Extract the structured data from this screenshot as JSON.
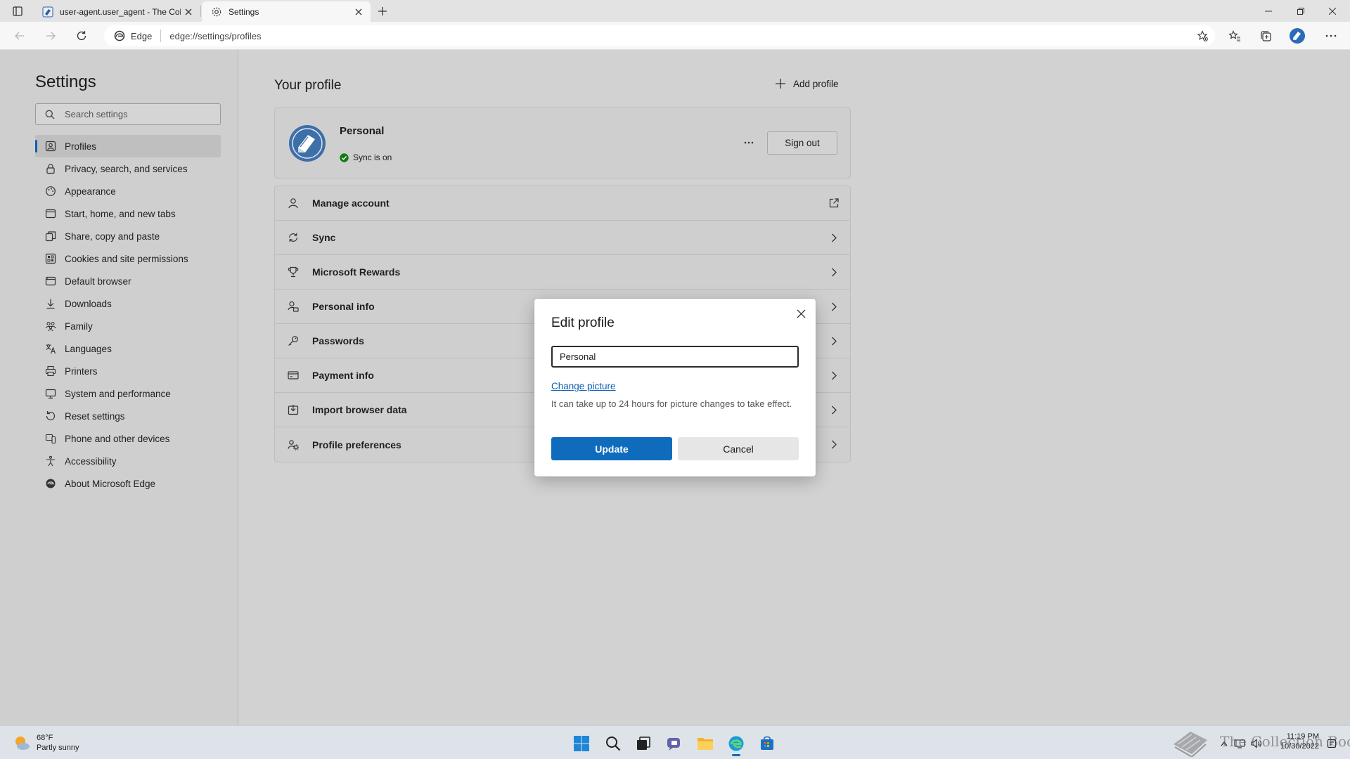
{
  "browser": {
    "tabs": [
      {
        "title": "user-agent.user_agent - The Coll",
        "icon": "book-icon"
      },
      {
        "title": "Settings",
        "icon": "gear-icon"
      }
    ],
    "address": {
      "badge": "Edge",
      "url": "edge://settings/profiles"
    }
  },
  "sidebar": {
    "title": "Settings",
    "search_placeholder": "Search settings",
    "items": [
      {
        "label": "Profiles",
        "icon": "profile-icon",
        "selected": true
      },
      {
        "label": "Privacy, search, and services",
        "icon": "lock-icon"
      },
      {
        "label": "Appearance",
        "icon": "appearance-icon"
      },
      {
        "label": "Start, home, and new tabs",
        "icon": "home-icon"
      },
      {
        "label": "Share, copy and paste",
        "icon": "share-icon"
      },
      {
        "label": "Cookies and site permissions",
        "icon": "cookies-icon"
      },
      {
        "label": "Default browser",
        "icon": "browser-icon"
      },
      {
        "label": "Downloads",
        "icon": "download-icon"
      },
      {
        "label": "Family",
        "icon": "family-icon"
      },
      {
        "label": "Languages",
        "icon": "languages-icon"
      },
      {
        "label": "Printers",
        "icon": "printer-icon"
      },
      {
        "label": "System and performance",
        "icon": "system-icon"
      },
      {
        "label": "Reset settings",
        "icon": "reset-icon"
      },
      {
        "label": "Phone and other devices",
        "icon": "phone-icon"
      },
      {
        "label": "Accessibility",
        "icon": "accessibility-icon"
      },
      {
        "label": "About Microsoft Edge",
        "icon": "edge-icon"
      }
    ]
  },
  "main": {
    "heading": "Your profile",
    "add_profile": "Add profile",
    "profile": {
      "name": "Personal",
      "sync_status": "Sync is on",
      "sign_out": "Sign out"
    },
    "rows": [
      {
        "label": "Manage account",
        "icon": "person-icon",
        "end": "external-link-icon"
      },
      {
        "label": "Sync",
        "icon": "sync-icon",
        "end": "chevron-right-icon"
      },
      {
        "label": "Microsoft Rewards",
        "icon": "trophy-icon",
        "end": "chevron-right-icon"
      },
      {
        "label": "Personal info",
        "icon": "personal-info-icon",
        "end": "chevron-right-icon"
      },
      {
        "label": "Passwords",
        "icon": "key-icon",
        "end": "chevron-right-icon"
      },
      {
        "label": "Payment info",
        "icon": "card-icon",
        "end": "chevron-right-icon"
      },
      {
        "label": "Import browser data",
        "icon": "import-icon",
        "end": "chevron-right-icon"
      },
      {
        "label": "Profile preferences",
        "icon": "profile-prefs-icon",
        "end": "chevron-right-icon"
      }
    ]
  },
  "dialog": {
    "title": "Edit profile",
    "name_value": "Personal",
    "change_picture": "Change picture",
    "note": "It can take up to 24 hours for picture changes to take effect.",
    "update": "Update",
    "cancel": "Cancel"
  },
  "taskbar": {
    "weather": {
      "temp": "68°F",
      "condition": "Partly sunny"
    },
    "time": "11:19 PM",
    "date": "10/30/2022",
    "watermark": "The Collection Book"
  },
  "colors": {
    "accent": "#0f6cbd",
    "link": "#0f5fb0",
    "sync_green": "#107c10"
  }
}
